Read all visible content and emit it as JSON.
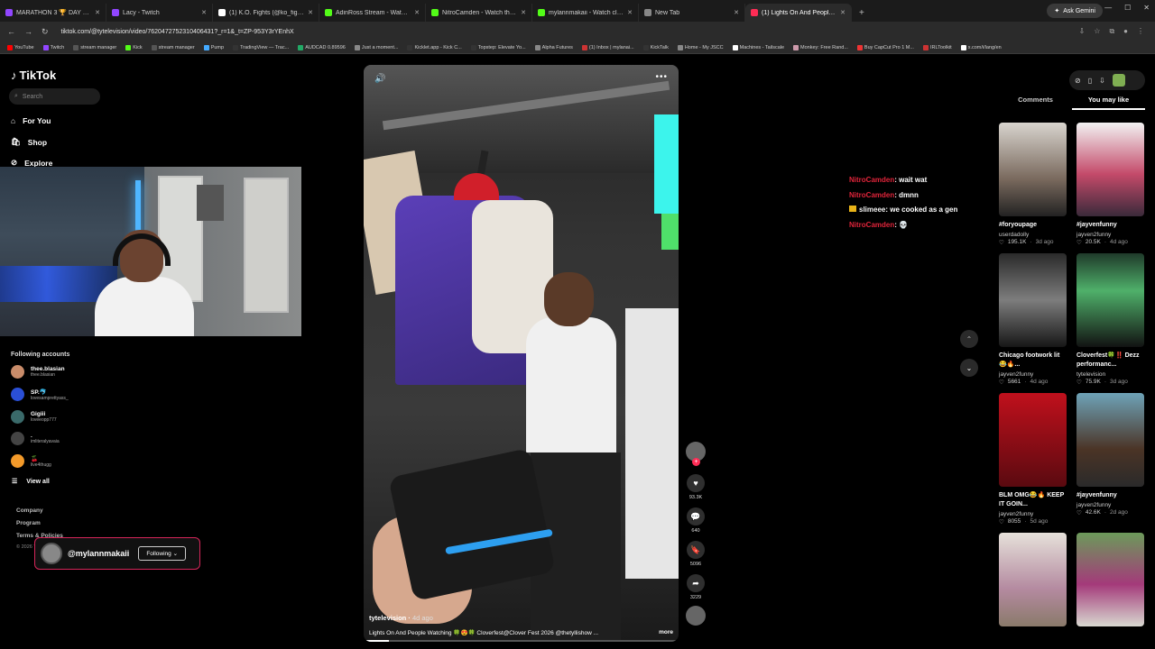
{
  "browser": {
    "tabs": [
      {
        "title": "MARATHON 3 🏆 DAY 1 🏆",
        "color": "#9146ff"
      },
      {
        "title": "Lacy - Twitch",
        "color": "#9146ff"
      },
      {
        "title": "(1) K.O. Fights (@ko_fights_) /",
        "color": "#ffffff"
      },
      {
        "title": "AdinRoss Stream - Watch Live",
        "color": "#53fc18"
      },
      {
        "title": "NitroCamden - Watch the VOD",
        "color": "#53fc18"
      },
      {
        "title": "mylannmakaii - Watch clips on",
        "color": "#53fc18"
      },
      {
        "title": "New Tab",
        "color": "#888888"
      },
      {
        "title": "(1) Lights On And People W",
        "color": "#fe2c55"
      }
    ],
    "gemini_label": "Ask Gemini",
    "url": "tiktok.com/@tytelevision/video/7620472752310406431?_r=1&_t=ZP-953Y3rYEnhX",
    "bookmarks": [
      "YouTube",
      "Twitch",
      "stream manager",
      "Kick",
      "stream manager",
      "Pump",
      "TradingView — Trac...",
      "AUDCAD 0.89596",
      "Just a moment...",
      "Kicklet.app - Kick C...",
      "Topstep: Elevate Yo...",
      "Alpha Futures",
      "(1) Inbox | mylanai...",
      "KickTalk",
      "Home - My JSCC",
      "Machines - Tailscale",
      "Monkey: Free Rand...",
      "Buy CapCut Pro 1 M...",
      "IRLToolkit",
      "x.com/i/lang/en"
    ]
  },
  "sidebar": {
    "logo": "TikTok",
    "search_placeholder": "Search",
    "nav": [
      "For You",
      "Shop",
      "Explore"
    ],
    "following_header": "Following accounts",
    "accounts": [
      {
        "name": "thee.blasian",
        "user": "thee.blasian",
        "color": "#c98c6a"
      },
      {
        "name": "SP.🐬",
        "user": "lovesamprettyass_",
        "color": "#2a4fd6"
      },
      {
        "name": "Gigiii",
        "user": "loveeopp777",
        "color": "#3a6a6a"
      },
      {
        "name": ".",
        "user": "imliteralyavaia",
        "color": "#444444"
      },
      {
        "name": "🍒",
        "user": "live4thugg",
        "color": "#f39a2a"
      }
    ],
    "view_all": "View all",
    "footer": [
      "Company",
      "Program",
      "Terms & Policies"
    ],
    "copyright": "© 2026 TikTok"
  },
  "follow_card": {
    "username": "@mylannmakaii",
    "button": "Following"
  },
  "video": {
    "author": "tytelevision",
    "age": "4d ago",
    "caption": "Lights On And People Watching 🍀😍🍀 Cloverfest@Clover Fest 2026 @thetyllishow ...",
    "more": "more",
    "progress": 0.08
  },
  "actions": {
    "likes": "93.3K",
    "comments": "640",
    "saves": "5096",
    "shares": "3229"
  },
  "chat": [
    {
      "user": "NitroCamden",
      "msg": ": wait wat",
      "color": "#e0243a",
      "badge": false
    },
    {
      "user": "NitroCamden",
      "msg": ": dmnn",
      "color": "#e0243a",
      "badge": false
    },
    {
      "user": "slimeee",
      "msg": ": we cooked as a gen",
      "color": "#f2f2f2",
      "badge": true
    },
    {
      "user": "NitroCamden",
      "msg": ": 💀",
      "color": "#e0243a",
      "badge": false
    }
  ],
  "right_panel": {
    "tabs": [
      "Comments",
      "You may like"
    ],
    "active_tab": "You may like",
    "cards": [
      {
        "title": "#foryoupage",
        "user": "userdadolly",
        "likes": "195.1K",
        "age": "3d ago",
        "bg": "linear-gradient(180deg,#d8d4ce,#7a6a5e 60%,#222)"
      },
      {
        "title": "#jayvenfunny",
        "user": "jayven2funny",
        "likes": "20.5K",
        "age": "4d ago",
        "bg": "linear-gradient(180deg,#f2f2f2,#c44a6a 55%,#3a2a3a)"
      },
      {
        "title": "Chicago footwork lit😂🔥...",
        "user": "jayven2funny",
        "likes": "5661",
        "age": "4d ago",
        "bg": "linear-gradient(180deg,#2a2a2a,#7d7d7d 50%,#161616)"
      },
      {
        "title": "Cloverfest🍀‼️ Dezz performanc...",
        "user": "tytelevision",
        "likes": "75.9K",
        "age": "3d ago",
        "bg": "linear-gradient(180deg,#1f3a2a,#4fb06a 40%,#121212)"
      },
      {
        "title": "BLM OMG😂🔥 KEEP IT GOIN...",
        "user": "jayven2funny",
        "likes": "8055",
        "age": "5d ago",
        "bg": "linear-gradient(180deg,#c0101c,#5a0a10)"
      },
      {
        "title": "#jayvenfunny",
        "user": "jayven2funny",
        "likes": "42.6K",
        "age": "2d ago",
        "bg": "linear-gradient(180deg,#6ea3b8,#4b3426 60%,#2a2a2a)"
      },
      {
        "title": "",
        "user": "",
        "likes": "",
        "age": "",
        "bg": "linear-gradient(180deg,#e6e1da,#b48aa0 60%,#8a7a6a)"
      },
      {
        "title": "",
        "user": "",
        "likes": "",
        "age": "",
        "bg": "linear-gradient(180deg,#6b9a5a,#a43a7a 55%,#d8d8d0)"
      }
    ]
  }
}
